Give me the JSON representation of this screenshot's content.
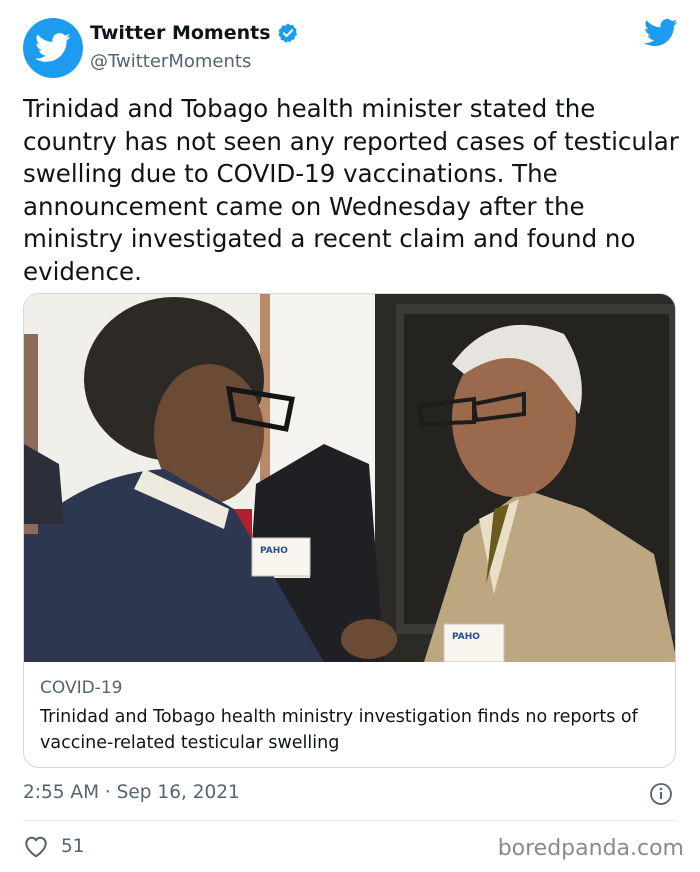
{
  "author": {
    "display_name": "Twitter Moments",
    "handle": "@TwitterMoments",
    "verified": true,
    "avatar_icon": "twitter-bird-icon",
    "brand_color": "#1d9bf0"
  },
  "tweet": {
    "text": "Trinidad and Tobago health minister stated the country has not seen any reported cases of testicular swelling due to COVID-19 vaccinations. The announcement came on Wednesday after the ministry investigated a recent claim and found no evidence.",
    "timestamp": "2:55 AM · Sep 16, 2021",
    "likes": "51"
  },
  "card": {
    "domain": "COVID-19",
    "title": "Trinidad and Tobago health ministry investigation finds no reports of vaccine-related testicular swelling",
    "image": {
      "badge_left": "PAHO",
      "badge_right": "PAHO"
    }
  },
  "icons": {
    "logo": "twitter-bird-icon",
    "verified": "verified-badge-icon",
    "info": "info-icon",
    "like": "heart-icon"
  },
  "watermark": "boredpanda.com"
}
